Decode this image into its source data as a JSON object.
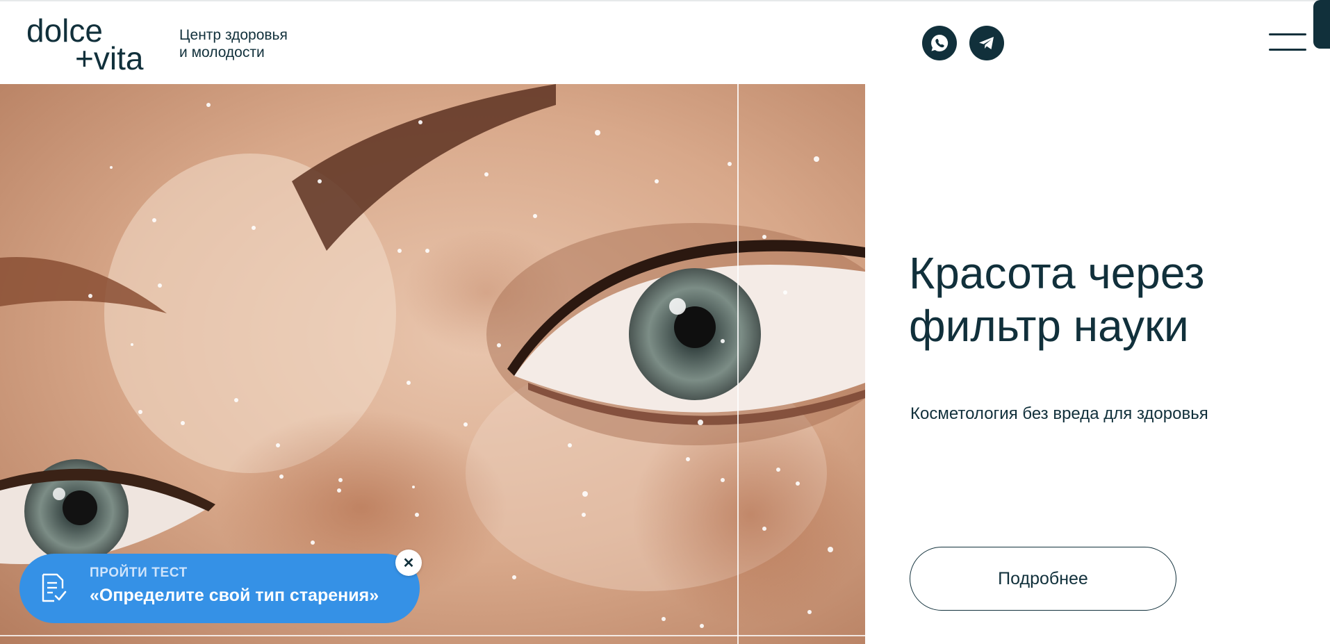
{
  "brand": {
    "logo_line1": "dolce",
    "logo_line2": "+vita",
    "tagline_line1": "Центр здоровья",
    "tagline_line2": "и молодости"
  },
  "header": {
    "social": [
      {
        "name": "WhatsApp",
        "icon": "whatsapp-icon"
      },
      {
        "name": "Telegram",
        "icon": "telegram-icon"
      }
    ],
    "menu_icon": "hamburger-menu-icon"
  },
  "hero": {
    "headline_line1": "Красота через",
    "headline_line2": "фильтр науки",
    "subheadline": "Косметология без вреда для здоровья",
    "cta_label": "Подробнее",
    "image_description_icon": "face-closeup-photo"
  },
  "quiz_banner": {
    "kicker": "ПРОЙТИ ТЕСТ",
    "title": "«Определите свой тип старения»",
    "icon": "checklist-icon",
    "close_icon": "close-icon"
  },
  "colors": {
    "brand_dark": "#11303b",
    "accent_blue": "#3591e6",
    "background": "#ffffff"
  }
}
